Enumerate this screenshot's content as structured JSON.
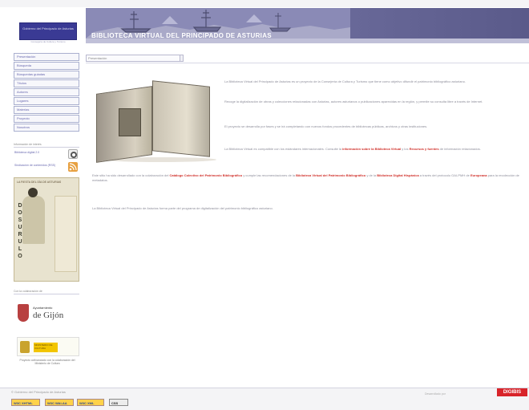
{
  "header": {
    "gov_logo_text": "Gobierno del Principado de Asturias",
    "gov_logo_sub": "Consejería de Cultura y Turismo",
    "title": "BIBLIOTECA VIRTUAL DEL PRINCIPADO DE ASTURIAS"
  },
  "sidebar": {
    "menu": [
      "Presentación",
      "Búsqueda",
      "Búsquedas guiadas",
      "Títulos",
      "Autores",
      "Lugares",
      "Materias",
      "Proyecto",
      "Nosotros"
    ],
    "news_header": "Información de interés",
    "news_rows": [
      {
        "text": "Biblioteca digital 2.0",
        "icon": "digital-icon"
      },
      {
        "text": "Sindicación de contenidos (RSS)",
        "icon": "rss-icon"
      }
    ],
    "poster": {
      "title": "LA FIESTA DEL DÍA DE ASTURIAS",
      "vertical": [
        "D",
        "O",
        "S",
        "U",
        "R",
        "U",
        "L",
        "O"
      ]
    },
    "sponsors_header": "Con la colaboración de",
    "gijon": {
      "line1": "Ayuntamiento",
      "line2": "de Gijón"
    },
    "ministerio": {
      "band": "MINISTERIO DE CULTURA",
      "text": "Proyecto cofinanciado con la colaboración del Ministerio de Cultura"
    }
  },
  "search": {
    "value": "Presentación"
  },
  "content": {
    "p1": "La Biblioteca Virtual del Principado de Asturias es un proyecto de la Consejería de Cultura y Turismo que tiene como objetivo difundir el patrimonio bibliográfico asturiano.",
    "p2": "Recoge la digitalización de obras y colecciones relacionadas con Asturias, autores asturianos o publicaciones aparecidas en la región, y permite su consulta libre a través de Internet.",
    "p3": "El proyecto se desarrolla por fases y se irá completando con nuevos fondos procedentes de bibliotecas públicas, archivos y otras instituciones.",
    "p4_pre": "La Biblioteca Virtual es compatible con los estándares internacionales. Consulte la ",
    "p4_link1": "información sobre la Biblioteca Virtual",
    "p4_mid": " y los ",
    "p4_link2": "Recursos y fuentes",
    "p4_post": " de información relacionados.",
    "p5_pre": "Este sitio ha sido desarrollado con la colaboración del ",
    "p5_link1": "Catálogo Colectivo del Patrimonio Bibliográfico",
    "p5_mid": " y cumple las recomendaciones de la ",
    "p5_link2": "Biblioteca Virtual del Patrimonio Bibliográfico",
    "p5_mid2": " y de la ",
    "p5_link3": "Biblioteca Digital Hispánica",
    "p5_mid3": " a través del protocolo OAI-PMH de ",
    "p5_link4": "Europeana",
    "p5_post": " para la recolección de metadatos.",
    "p6": "La Biblioteca Virtual del Principado de Asturias forma parte del programa de digitalización del patrimonio bibliográfico asturiano."
  },
  "footer": {
    "status": "© Gobierno del Principado de Asturias",
    "copy": "Desarrollado por",
    "digibis": "DIGIBIS",
    "badges": [
      "W3C XHTML",
      "W3C WAI-AA",
      "W3C XML",
      "CSS"
    ]
  }
}
